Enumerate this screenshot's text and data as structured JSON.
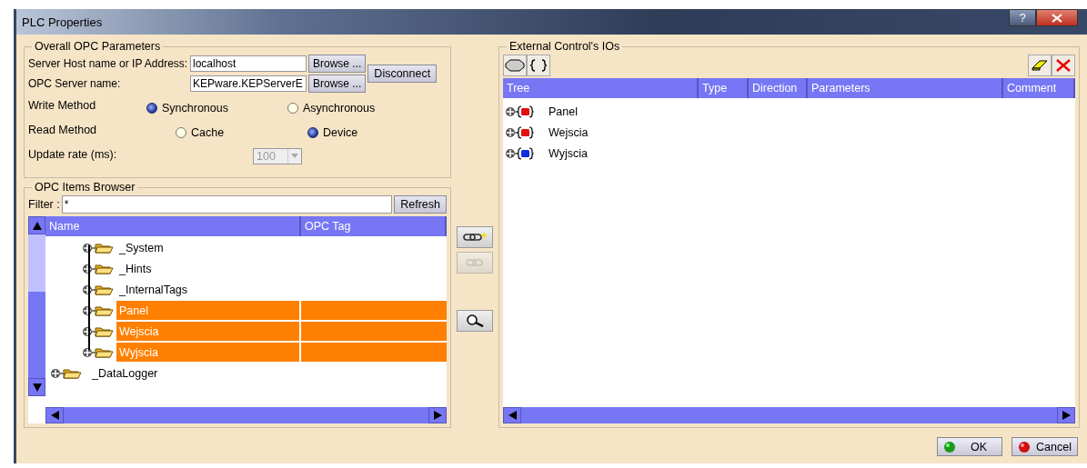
{
  "window": {
    "title": "PLC Properties",
    "help_button": "?"
  },
  "opc_parameters": {
    "title": "Overall OPC Parameters",
    "host": {
      "label": "Server Host name or IP Address:",
      "value": "localhost",
      "browse": "Browse ..."
    },
    "server": {
      "label": "OPC Server name:",
      "value": "KEPware.KEPServerE",
      "browse": "Browse ..."
    },
    "disconnect": "Disconnect",
    "write_method": {
      "label": "Write Method",
      "options": [
        {
          "label": "Synchronous",
          "selected": true
        },
        {
          "label": "Asynchronous",
          "selected": false
        }
      ]
    },
    "read_method": {
      "label": "Read Method",
      "options": [
        {
          "label": "Cache",
          "selected": false
        },
        {
          "label": "Device",
          "selected": true
        }
      ]
    },
    "update_rate": {
      "label": "Update rate (ms):",
      "value": "100",
      "disabled": true
    }
  },
  "items_browser": {
    "title": "OPC Items Browser",
    "filter_label": "Filter :",
    "filter_value": "*",
    "refresh": "Refresh",
    "columns": [
      "Name",
      "OPC Tag"
    ],
    "items": [
      {
        "children": [
          {
            "label": "_System",
            "selected": false
          },
          {
            "label": "_Hints",
            "selected": false
          },
          {
            "label": "_InternalTags",
            "selected": false
          },
          {
            "label": "Panel",
            "selected": true
          },
          {
            "label": "Wejscia",
            "selected": true
          },
          {
            "label": "Wyjscia",
            "selected": true
          }
        ]
      },
      {
        "label": "_DataLogger",
        "selected": false
      }
    ]
  },
  "middle_buttons": [
    {
      "kind": "link-add",
      "disabled": false
    },
    {
      "kind": "link",
      "disabled": true
    },
    {
      "kind": "search",
      "disabled": false
    }
  ],
  "external_ios": {
    "title": "External Control's IOs",
    "columns": [
      "Tree",
      "Type",
      "Direction",
      "Parameters",
      "Comment"
    ],
    "rows": [
      {
        "label": "Panel",
        "color": "#e01010"
      },
      {
        "label": "Wejscia",
        "color": "#e01010"
      },
      {
        "label": "Wyjscia",
        "color": "#1030e0"
      }
    ]
  },
  "footer": {
    "ok": "OK",
    "cancel": "Cancel"
  }
}
